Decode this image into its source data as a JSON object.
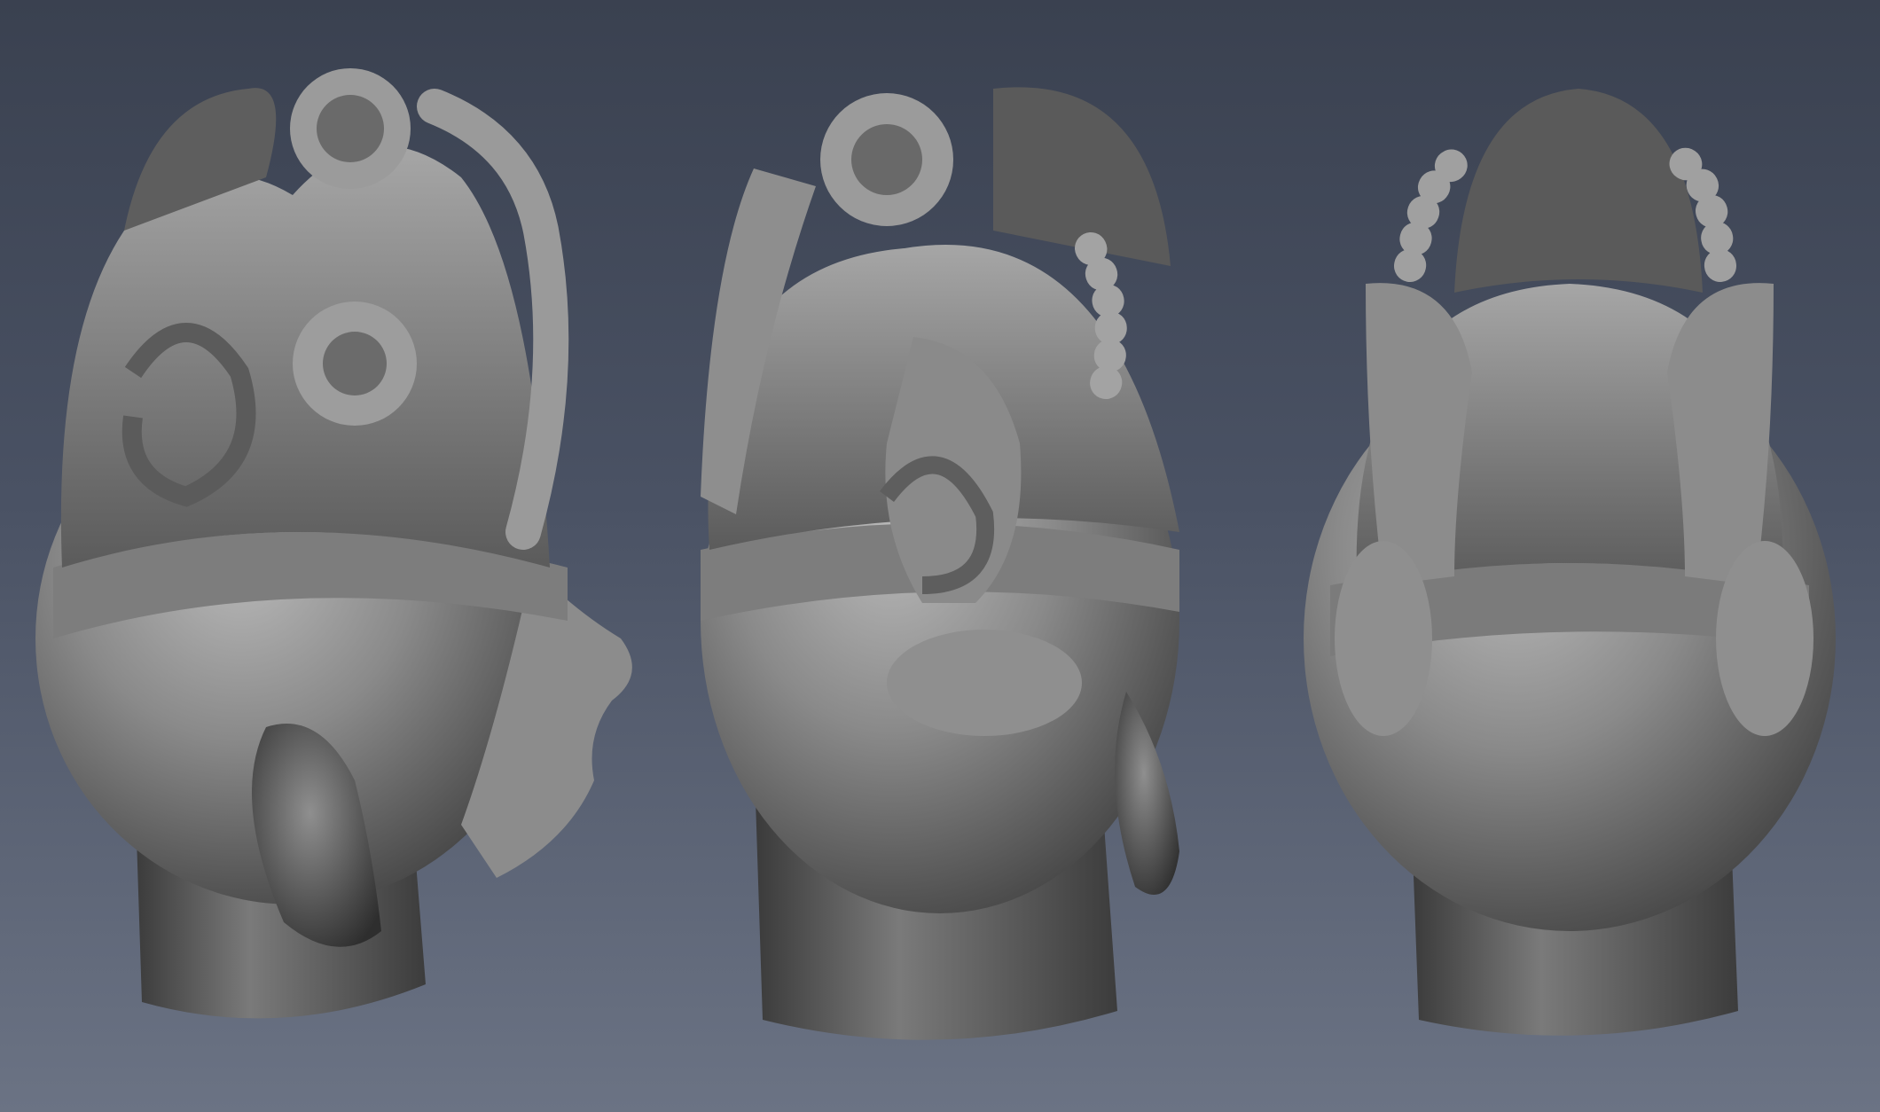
{
  "scene": {
    "views": [
      {
        "name": "three-quarter-left-view"
      },
      {
        "name": "back-three-quarter-view"
      },
      {
        "name": "rear-view"
      }
    ]
  }
}
